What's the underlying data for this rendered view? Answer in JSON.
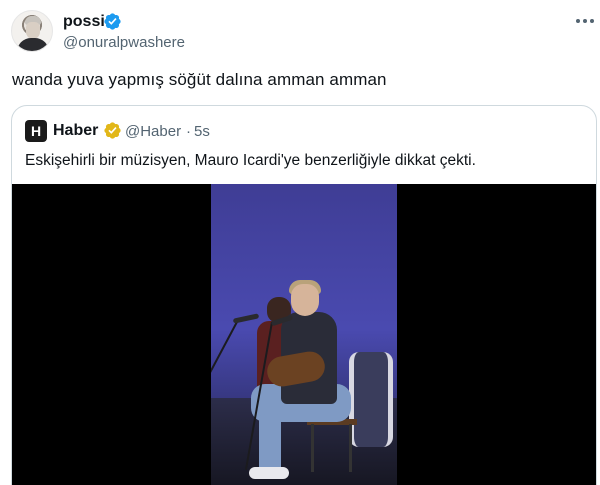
{
  "tweet": {
    "display_name": "possi",
    "handle": "@onuralpwashere",
    "text": "wanda yuva yapmış söğüt dalına amman amman",
    "verified_color": "#1d9bf0"
  },
  "quote": {
    "avatar_letter": "H",
    "display_name": "Haber",
    "handle": "@Haber",
    "separator": "·",
    "time": "5s",
    "text": "Eskişehirli bir müzisyen, Mauro Icardi'ye benzerliğiyle dikkat çekti.",
    "verified_color": "#e2b719"
  },
  "icons": [
    "more-icon",
    "verified-badge-icon",
    "gold-verified-badge-icon"
  ]
}
